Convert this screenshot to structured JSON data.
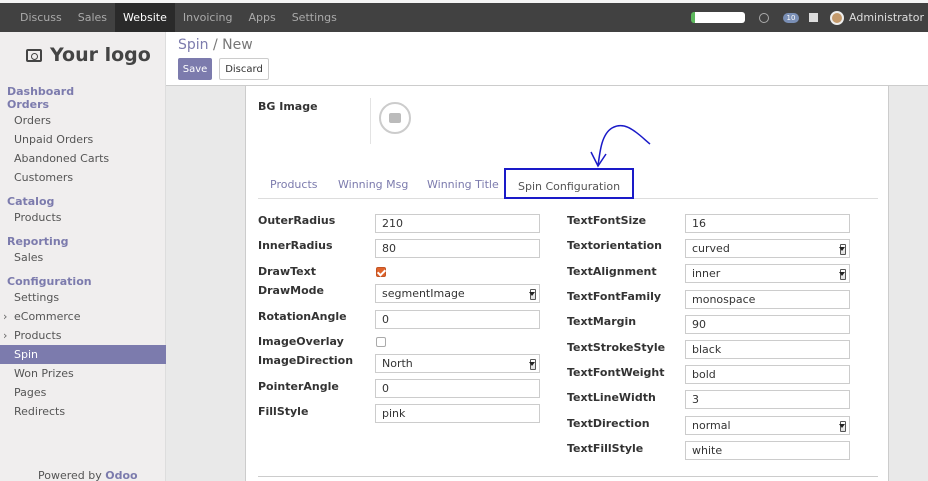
{
  "topbar": {
    "menus": [
      "Discuss",
      "Sales",
      "Website",
      "Invoicing",
      "Apps",
      "Settings"
    ],
    "active_menu": "Website",
    "chat_count": "10",
    "user": "Administrator"
  },
  "sidebar": {
    "logo": "Your logo",
    "sections": [
      {
        "title": "Dashboard",
        "items": []
      },
      {
        "title": "Orders",
        "items": [
          "Orders",
          "Unpaid Orders",
          "Abandoned Carts",
          "Customers"
        ]
      },
      {
        "title": "Catalog",
        "items": [
          "Products"
        ]
      },
      {
        "title": "Reporting",
        "items": [
          "Sales"
        ]
      },
      {
        "title": "Configuration",
        "items": [
          "Settings",
          "eCommerce",
          "Products",
          "Spin",
          "Won Prizes",
          "Pages",
          "Redirects"
        ]
      }
    ],
    "active_item": "Spin",
    "powered_prefix": "Powered by",
    "powered_brand": "Odoo"
  },
  "control": {
    "breadcrumb_parent": "Spin",
    "breadcrumb_sep": "/",
    "breadcrumb_current": "New",
    "save_label": "Save",
    "discard_label": "Discard"
  },
  "form": {
    "bg_image_label": "BG Image",
    "tabs": [
      "Products",
      "Winning Msg",
      "Winning Title",
      "Spin Configuration"
    ],
    "active_tab": "Spin Configuration",
    "left": {
      "outer_radius": {
        "label": "OuterRadius",
        "value": "210"
      },
      "inner_radius": {
        "label": "InnerRadius",
        "value": "80"
      },
      "draw_text": {
        "label": "DrawText",
        "checked": true
      },
      "draw_mode": {
        "label": "DrawMode",
        "value": "segmentImage"
      },
      "rotation_angle": {
        "label": "RotationAngle",
        "value": "0"
      },
      "image_overlay": {
        "label": "ImageOverlay",
        "checked": false
      },
      "image_direction": {
        "label": "ImageDirection",
        "value": "North"
      },
      "pointer_angle": {
        "label": "PointerAngle",
        "value": "0"
      },
      "fill_style": {
        "label": "FillStyle",
        "value": "pink"
      }
    },
    "right": {
      "text_font_size": {
        "label": "TextFontSize",
        "value": "16"
      },
      "text_orientation": {
        "label": "Textorientation",
        "value": "curved"
      },
      "text_alignment": {
        "label": "TextAlignment",
        "value": "inner"
      },
      "text_font_family": {
        "label": "TextFontFamily",
        "value": "monospace"
      },
      "text_margin": {
        "label": "TextMargin",
        "value": "90"
      },
      "text_stroke_style": {
        "label": "TextStrokeStyle",
        "value": "black"
      },
      "text_font_weight": {
        "label": "TextFontWeight",
        "value": "bold"
      },
      "text_line_width": {
        "label": "TextLineWidth",
        "value": "3"
      },
      "text_direction": {
        "label": "TextDirection",
        "value": "normal"
      },
      "text_fill_style": {
        "label": "TextFillStyle",
        "value": "white"
      }
    }
  },
  "colors": {
    "accent": "#7c7bad",
    "tab_highlight": "#1a1ac8",
    "checkbox_on": "#e0632b"
  }
}
